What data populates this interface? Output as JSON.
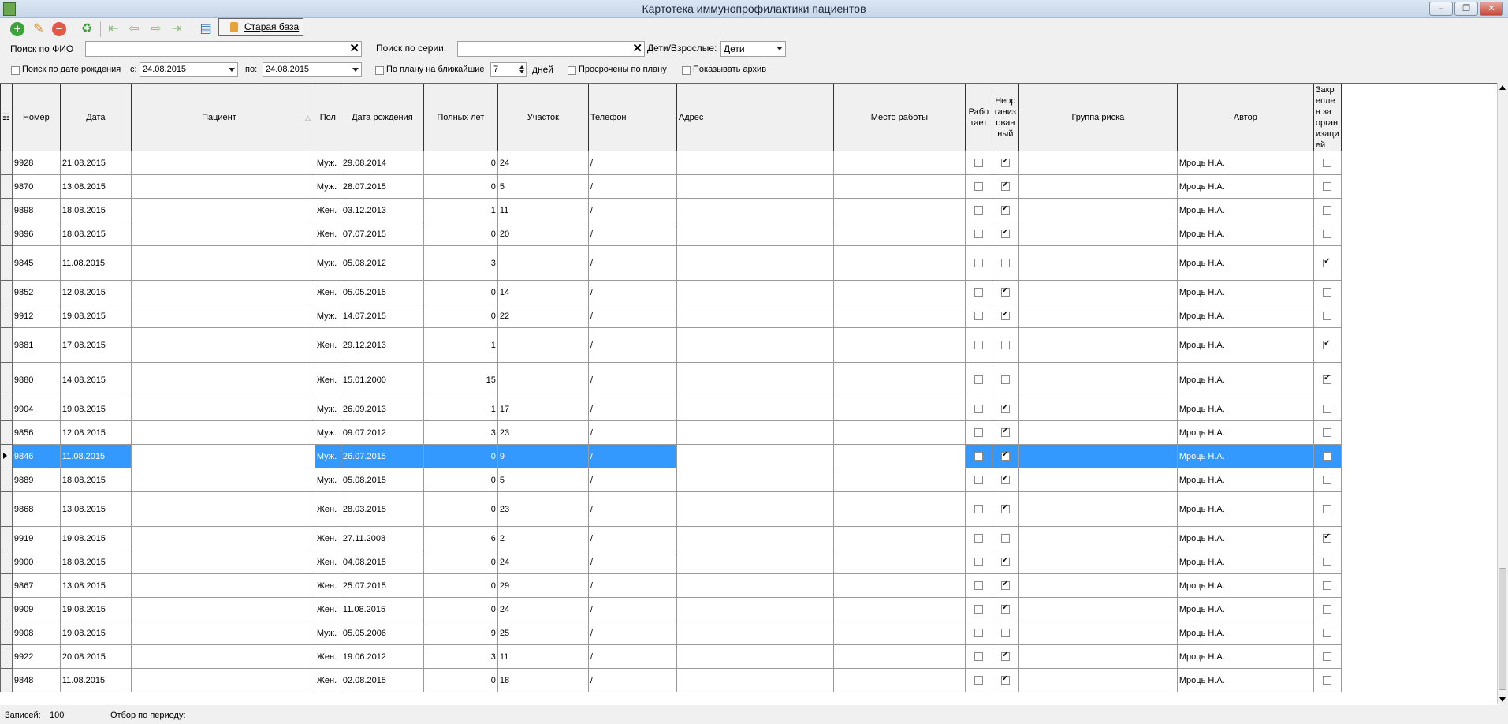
{
  "window": {
    "title": "Картотека иммунопрофилактики пациентов"
  },
  "toolbar": {
    "old_db_label": "Старая база"
  },
  "filters": {
    "fio_label": "Поиск по ФИО",
    "series_label": "Поиск по серии:",
    "age_label": "Дети/Взрослые:",
    "age_value": "Дети",
    "birth_label": "Поиск по дате рождения",
    "from_label": "с:",
    "from_value": "24.08.2015",
    "to_label": "по:",
    "to_value": "24.08.2015",
    "plan_label": "По плану на ближайшие",
    "plan_days": "7",
    "days_label": "дней",
    "overdue_label": "Просрочены по плану",
    "archive_label": "Показывать архив"
  },
  "grid": {
    "columns": [
      "Номер",
      "Дата",
      "Пациент",
      "Пол",
      "Дата рождения",
      "Полных лет",
      "Участок",
      "Телефон",
      "Адрес",
      "Место работы",
      "Рабо тает",
      "Неор ганиз ован ный",
      "Группа риска",
      "Автор",
      "Закр епле н за орган изаци ей"
    ],
    "rows": [
      {
        "num": "9928",
        "date": "21.08.2015",
        "sex": "Муж.",
        "birth": "29.08.2014",
        "years": "0",
        "area": "24",
        "phone": "/",
        "works": false,
        "unorg": true,
        "author": "Мроць Н.А.",
        "attached": false
      },
      {
        "num": "9870",
        "date": "13.08.2015",
        "sex": "Муж.",
        "birth": "28.07.2015",
        "years": "0",
        "area": "5",
        "phone": "/",
        "works": false,
        "unorg": true,
        "author": "Мроць Н.А.",
        "attached": false
      },
      {
        "num": "9898",
        "date": "18.08.2015",
        "sex": "Жен.",
        "birth": "03.12.2013",
        "years": "1",
        "area": "11",
        "phone": "/",
        "works": false,
        "unorg": true,
        "author": "Мроць Н.А.",
        "attached": false
      },
      {
        "num": "9896",
        "date": "18.08.2015",
        "sex": "Жен.",
        "birth": "07.07.2015",
        "years": "0",
        "area": "20",
        "phone": "/",
        "works": false,
        "unorg": true,
        "author": "Мроць Н.А.",
        "attached": false
      },
      {
        "num": "9845",
        "date": "11.08.2015",
        "sex": "Муж.",
        "birth": "05.08.2012",
        "years": "3",
        "area": "",
        "phone": "/",
        "works": false,
        "unorg": false,
        "author": "Мроць Н.А.",
        "attached": true,
        "tall": true
      },
      {
        "num": "9852",
        "date": "12.08.2015",
        "sex": "Жен.",
        "birth": "05.05.2015",
        "years": "0",
        "area": "14",
        "phone": "/",
        "works": false,
        "unorg": true,
        "author": "Мроць Н.А.",
        "attached": false
      },
      {
        "num": "9912",
        "date": "19.08.2015",
        "sex": "Муж.",
        "birth": "14.07.2015",
        "years": "0",
        "area": "22",
        "phone": "/",
        "works": false,
        "unorg": true,
        "author": "Мроць Н.А.",
        "attached": false
      },
      {
        "num": "9881",
        "date": "17.08.2015",
        "sex": "Жен.",
        "birth": "29.12.2013",
        "years": "1",
        "area": "",
        "phone": "/",
        "works": false,
        "unorg": false,
        "author": "Мроць Н.А.",
        "attached": true,
        "tall": true
      },
      {
        "num": "9880",
        "date": "14.08.2015",
        "sex": "Жен.",
        "birth": "15.01.2000",
        "years": "15",
        "area": "",
        "phone": "/",
        "works": false,
        "unorg": false,
        "author": "Мроць Н.А.",
        "attached": true,
        "tall": true
      },
      {
        "num": "9904",
        "date": "19.08.2015",
        "sex": "Муж.",
        "birth": "26.09.2013",
        "years": "1",
        "area": "17",
        "phone": "/",
        "works": false,
        "unorg": true,
        "author": "Мроць Н.А.",
        "attached": false
      },
      {
        "num": "9856",
        "date": "12.08.2015",
        "sex": "Муж.",
        "birth": "09.07.2012",
        "years": "3",
        "area": "23",
        "phone": "/",
        "works": false,
        "unorg": true,
        "author": "Мроць Н.А.",
        "attached": false
      },
      {
        "num": "9846",
        "date": "11.08.2015",
        "sex": "Муж.",
        "birth": "26.07.2015",
        "years": "0",
        "area": "9",
        "phone": "/",
        "works": false,
        "unorg": true,
        "author": "Мроць Н.А.",
        "attached": false,
        "selected": true
      },
      {
        "num": "9889",
        "date": "18.08.2015",
        "sex": "Муж.",
        "birth": "05.08.2015",
        "years": "0",
        "area": "5",
        "phone": "/",
        "works": false,
        "unorg": true,
        "author": "Мроць Н.А.",
        "attached": false
      },
      {
        "num": "9868",
        "date": "13.08.2015",
        "sex": "Жен.",
        "birth": "28.03.2015",
        "years": "0",
        "area": "23",
        "phone": "/",
        "works": false,
        "unorg": true,
        "author": "Мроць Н.А.",
        "attached": false,
        "tall": true
      },
      {
        "num": "9919",
        "date": "19.08.2015",
        "sex": "Жен.",
        "birth": "27.11.2008",
        "years": "6",
        "area": "2",
        "phone": "/",
        "works": false,
        "unorg": false,
        "author": "Мроць Н.А.",
        "attached": true
      },
      {
        "num": "9900",
        "date": "18.08.2015",
        "sex": "Жен.",
        "birth": "04.08.2015",
        "years": "0",
        "area": "24",
        "phone": "/",
        "works": false,
        "unorg": true,
        "author": "Мроць Н.А.",
        "attached": false
      },
      {
        "num": "9867",
        "date": "13.08.2015",
        "sex": "Жен.",
        "birth": "25.07.2015",
        "years": "0",
        "area": "29",
        "phone": "/",
        "works": false,
        "unorg": true,
        "author": "Мроць Н.А.",
        "attached": false
      },
      {
        "num": "9909",
        "date": "19.08.2015",
        "sex": "Жен.",
        "birth": "11.08.2015",
        "years": "0",
        "area": "24",
        "phone": "/",
        "works": false,
        "unorg": true,
        "author": "Мроць Н.А.",
        "attached": false
      },
      {
        "num": "9908",
        "date": "19.08.2015",
        "sex": "Муж.",
        "birth": "05.05.2006",
        "years": "9",
        "area": "25",
        "phone": "/",
        "works": false,
        "unorg": false,
        "author": "Мроць Н.А.",
        "attached": false
      },
      {
        "num": "9922",
        "date": "20.08.2015",
        "sex": "Жен.",
        "birth": "19.06.2012",
        "years": "3",
        "area": "11",
        "phone": "/",
        "works": false,
        "unorg": true,
        "author": "Мроць Н.А.",
        "attached": false
      },
      {
        "num": "9848",
        "date": "11.08.2015",
        "sex": "Жен.",
        "birth": "02.08.2015",
        "years": "0",
        "area": "18",
        "phone": "/",
        "works": false,
        "unorg": true,
        "author": "Мроць Н.А.",
        "attached": false
      }
    ]
  },
  "status": {
    "records_label": "Записей:",
    "records_value": "100",
    "period_label": "Отбор по периоду:"
  }
}
